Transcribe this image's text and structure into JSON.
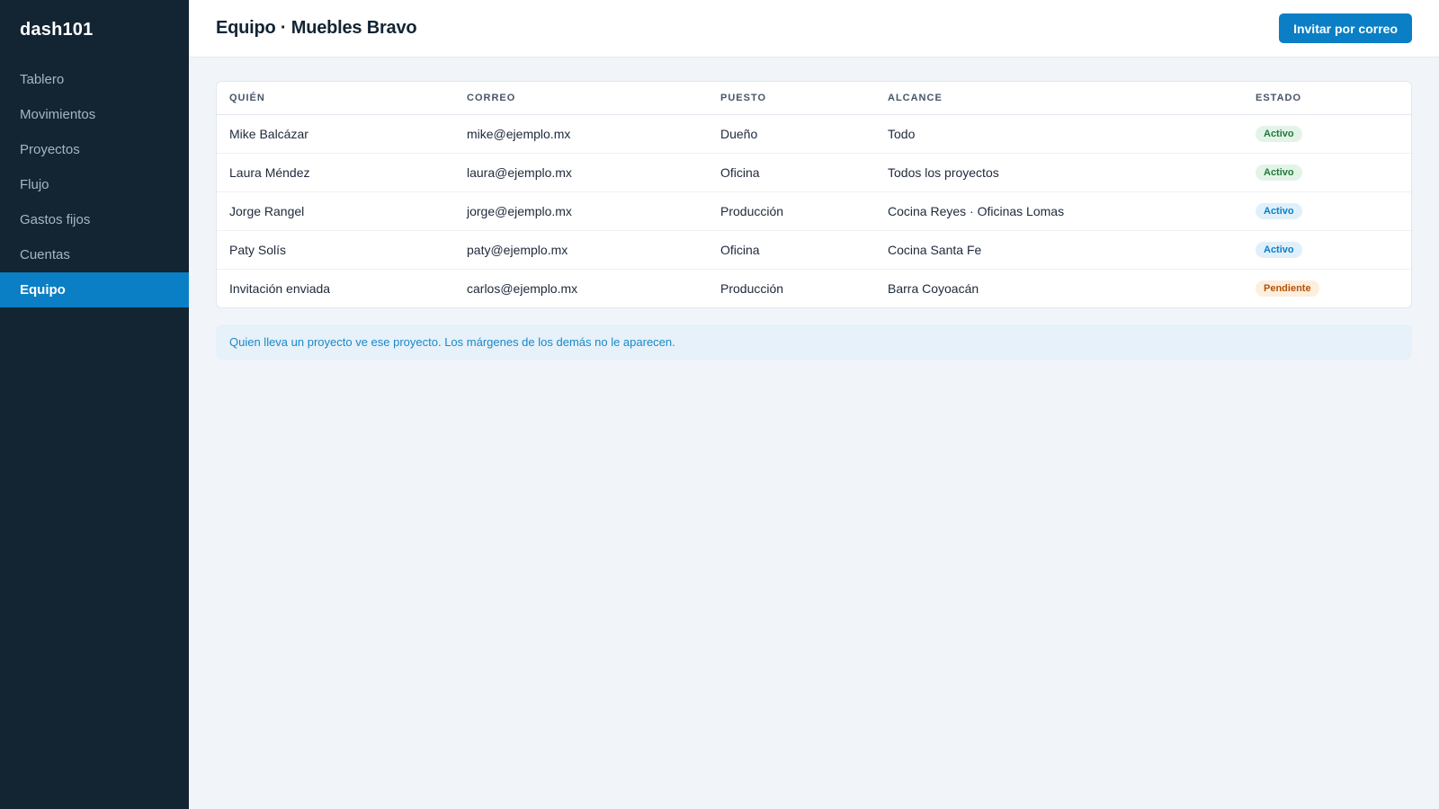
{
  "app": {
    "brand": "dash101"
  },
  "sidebar": {
    "items": [
      {
        "label": "Tablero"
      },
      {
        "label": "Movimientos"
      },
      {
        "label": "Proyectos"
      },
      {
        "label": "Flujo"
      },
      {
        "label": "Gastos fijos"
      },
      {
        "label": "Cuentas"
      },
      {
        "label": "Equipo"
      }
    ],
    "active": "Equipo"
  },
  "header": {
    "title": "Equipo · Muebles Bravo",
    "invite_label": "Invitar por correo"
  },
  "table": {
    "columns": [
      "QUIÉN",
      "CORREO",
      "PUESTO",
      "ALCANCE",
      "ESTADO"
    ],
    "rows": [
      {
        "who": "Mike Balcázar",
        "email": "mike@ejemplo.mx",
        "role": "Dueño",
        "scope": "Todo",
        "status": "Activo",
        "status_color": "#1f7a3a"
      },
      {
        "who": "Laura Méndez",
        "email": "laura@ejemplo.mx",
        "role": "Oficina",
        "scope": "Todos los proyectos",
        "status": "Activo",
        "status_color": "#1f7a3a"
      },
      {
        "who": "Jorge Rangel",
        "email": "jorge@ejemplo.mx",
        "role": "Producción",
        "scope": "Cocina Reyes · Oficinas Lomas",
        "status": "Activo",
        "status_color": "#0a7fc5"
      },
      {
        "who": "Paty Solís",
        "email": "paty@ejemplo.mx",
        "role": "Oficina",
        "scope": "Cocina Santa Fe",
        "status": "Activo",
        "status_color": "#0a7fc5"
      },
      {
        "who": "Invitación enviada",
        "email": "carlos@ejemplo.mx",
        "role": "Producción",
        "scope": "Barra Coyoacán",
        "status": "Pendiente",
        "status_color": "#b45309"
      }
    ]
  },
  "note": {
    "text": "Quien lleva un proyecto ve ese proyecto. Los márgenes de los demás no le aparecen."
  },
  "colors": {
    "sidebar_bg": "#132433",
    "accent": "#0a7fc5",
    "page_bg": "#f1f5f9"
  }
}
